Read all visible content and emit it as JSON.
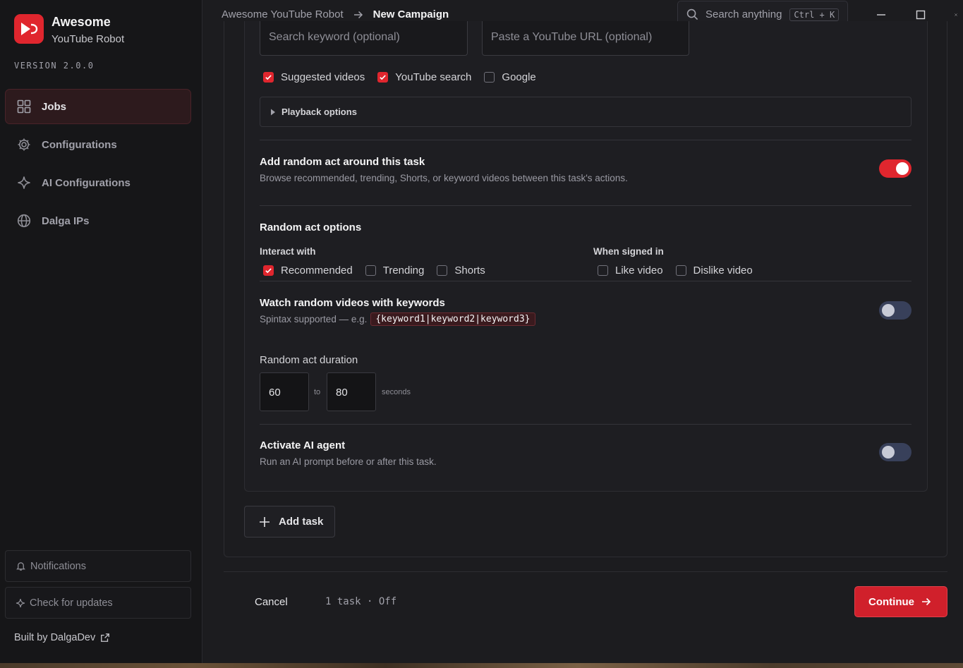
{
  "brand": {
    "title": "Awesome",
    "subtitle": "YouTube Robot",
    "version": "VERSION 2.0.0"
  },
  "nav": [
    {
      "label": "Jobs",
      "icon": "grid-icon",
      "active": true
    },
    {
      "label": "Configurations",
      "icon": "gear-icon"
    },
    {
      "label": "AI Configurations",
      "icon": "sparkle-icon"
    },
    {
      "label": "Dalga IPs",
      "icon": "globe-icon"
    }
  ],
  "sidebar_footer": {
    "notifications": "Notifications",
    "check_updates": "Check for updates",
    "built_by": "Built by DalgaDev"
  },
  "breadcrumb": {
    "root": "Awesome YouTube Robot",
    "current": "New Campaign"
  },
  "search": {
    "placeholder": "Search anything",
    "shortcut": "Ctrl + K"
  },
  "task": {
    "keyword_placeholder": "Search keyword (optional)",
    "url_placeholder": "Paste a YouTube URL (optional)",
    "sources": [
      {
        "label": "Suggested videos",
        "checked": true
      },
      {
        "label": "YouTube search",
        "checked": true
      },
      {
        "label": "Google",
        "checked": false
      }
    ],
    "playback_options": "Playback options",
    "random_act": {
      "title": "Add random act around this task",
      "description": "Browse recommended, trending, Shorts, or keyword videos between this task's actions.",
      "enabled": true
    },
    "random_act_options": {
      "title": "Random act options",
      "interact_with_label": "Interact with",
      "interact_with": [
        {
          "label": "Recommended",
          "checked": true
        },
        {
          "label": "Trending",
          "checked": false
        },
        {
          "label": "Shorts",
          "checked": false
        }
      ],
      "signed_in_label": "When signed in",
      "signed_in": [
        {
          "label": "Like video",
          "checked": false
        },
        {
          "label": "Dislike video",
          "checked": false
        }
      ]
    },
    "keywords": {
      "title": "Watch random videos with keywords",
      "description": "Spintax supported — e.g.",
      "example": "{keyword1|keyword2|keyword3}",
      "enabled": false
    },
    "duration": {
      "title": "Random act duration",
      "min": "60",
      "to": "to",
      "max": "80",
      "unit": "seconds"
    },
    "ai_agent": {
      "title": "Activate AI agent",
      "description": "Run an AI prompt before or after this task.",
      "enabled": false
    }
  },
  "add_task": "Add task",
  "footer": {
    "cancel": "Cancel",
    "status": "1 task · Off",
    "continue": "Continue"
  },
  "colors": {
    "accent": "#e0262e",
    "background": "#1c1c1f",
    "sidebar": "#161618"
  }
}
